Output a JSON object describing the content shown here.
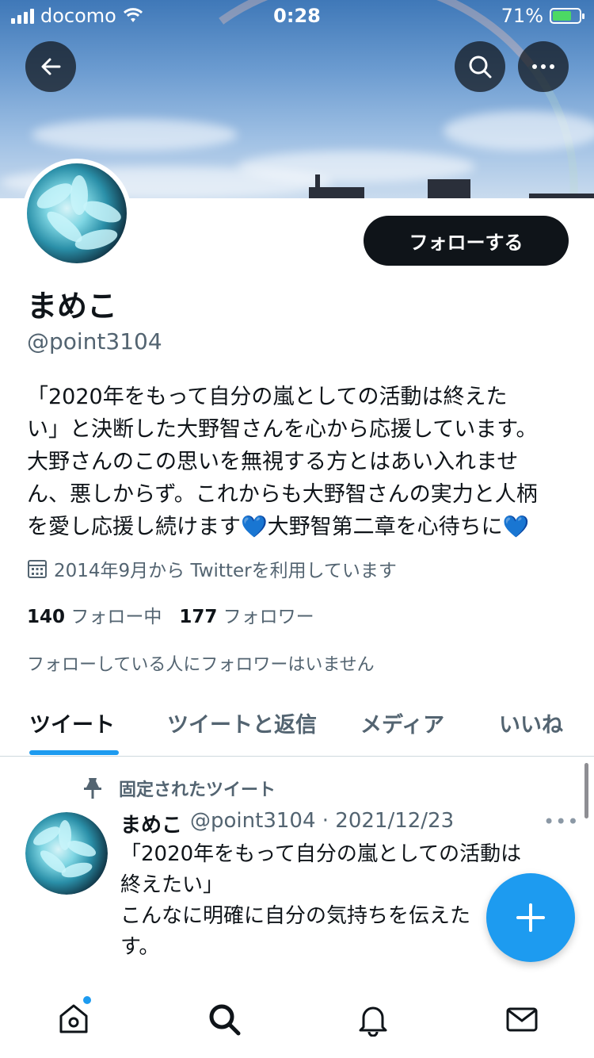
{
  "status_bar": {
    "carrier": "docomo",
    "time": "0:28",
    "battery": "71%",
    "battery_level": 0.71
  },
  "header": {
    "back_icon": "back-arrow-icon",
    "search_icon": "search-icon",
    "more_icon": "more-icon"
  },
  "profile": {
    "follow_label": "フォローする",
    "name": "まめこ",
    "handle": "@point3104",
    "bio_lines": [
      "「2020年をもって自分の嵐としての活動は終えた",
      "い」と決断した大野智さんを心から応援しています。",
      "大野さんのこの思いを無視する方とはあい入れませ",
      "ん、悪しからず。これからも大野智さんの実力と人柄",
      "を愛し応援し続けます💙大野智第二章を心待ちに💙"
    ],
    "joined": "2014年9月から Twitterを利用しています",
    "following_count": "140",
    "following_label": "フォロー中",
    "followers_count": "177",
    "followers_label": "フォロワー",
    "mutual_text": "フォローしている人にフォロワーはいません"
  },
  "tabs": [
    {
      "label": "ツイート",
      "active": true
    },
    {
      "label": "ツイートと返信",
      "active": false
    },
    {
      "label": "メディア",
      "active": false
    },
    {
      "label": "いいね",
      "active": false
    }
  ],
  "tweet": {
    "pinned_label": "固定されたツイート",
    "name": "まめこ",
    "handle_date": "@point3104 · 2021/12/23",
    "more": "•••",
    "lines": [
      "「2020年をもって自分の嵐としての活動は",
      "終えたい」",
      "こんなに明確に自分の気持ちを伝えた",
      "す。"
    ]
  },
  "fab": {
    "icon": "plus-icon"
  },
  "bottom_nav": [
    "home-icon",
    "search-icon",
    "notifications-icon",
    "messages-icon"
  ],
  "colors": {
    "accent": "#1d9bf0",
    "text": "#0f1419",
    "secondary": "#536471"
  }
}
